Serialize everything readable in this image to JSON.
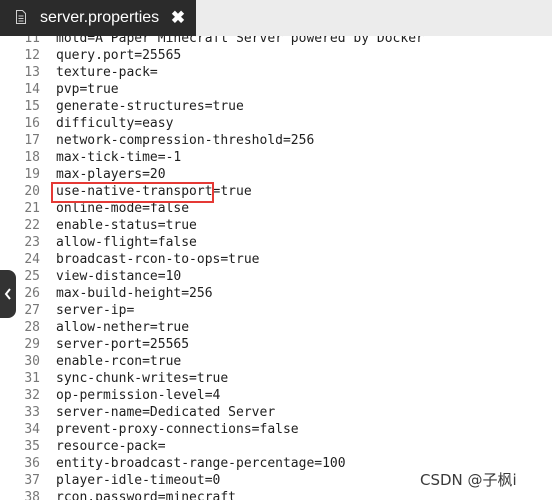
{
  "tab": {
    "title": "server.properties",
    "file_icon": "file-icon",
    "close_icon": "close-icon"
  },
  "editor": {
    "lines": [
      {
        "number": "11",
        "text": "motd=A Paper Minecraft Server powered by Docker"
      },
      {
        "number": "12",
        "text": "query.port=25565"
      },
      {
        "number": "13",
        "text": "texture-pack="
      },
      {
        "number": "14",
        "text": "pvp=true"
      },
      {
        "number": "15",
        "text": "generate-structures=true"
      },
      {
        "number": "16",
        "text": "difficulty=easy"
      },
      {
        "number": "17",
        "text": "network-compression-threshold=256"
      },
      {
        "number": "18",
        "text": "max-tick-time=-1"
      },
      {
        "number": "19",
        "text": "max-players=20"
      },
      {
        "number": "20",
        "text": "use-native-transport=true"
      },
      {
        "number": "21",
        "text": "online-mode=false"
      },
      {
        "number": "22",
        "text": "enable-status=true"
      },
      {
        "number": "23",
        "text": "allow-flight=false"
      },
      {
        "number": "24",
        "text": "broadcast-rcon-to-ops=true"
      },
      {
        "number": "25",
        "text": "view-distance=10"
      },
      {
        "number": "26",
        "text": "max-build-height=256"
      },
      {
        "number": "27",
        "text": "server-ip="
      },
      {
        "number": "28",
        "text": "allow-nether=true"
      },
      {
        "number": "29",
        "text": "server-port=25565"
      },
      {
        "number": "30",
        "text": "enable-rcon=true"
      },
      {
        "number": "31",
        "text": "sync-chunk-writes=true"
      },
      {
        "number": "32",
        "text": "op-permission-level=4"
      },
      {
        "number": "33",
        "text": "server-name=Dedicated Server"
      },
      {
        "number": "34",
        "text": "prevent-proxy-connections=false"
      },
      {
        "number": "35",
        "text": "resource-pack="
      },
      {
        "number": "36",
        "text": "entity-broadcast-range-percentage=100"
      },
      {
        "number": "37",
        "text": "player-idle-timeout=0"
      },
      {
        "number": "38",
        "text": "rcon.password=minecraft"
      }
    ],
    "highlighted_line": "18",
    "highlight_color": "#e53935"
  },
  "sidebar_toggle": {
    "icon": "chevron-left-icon"
  },
  "watermark": "CSDN @子枫i"
}
